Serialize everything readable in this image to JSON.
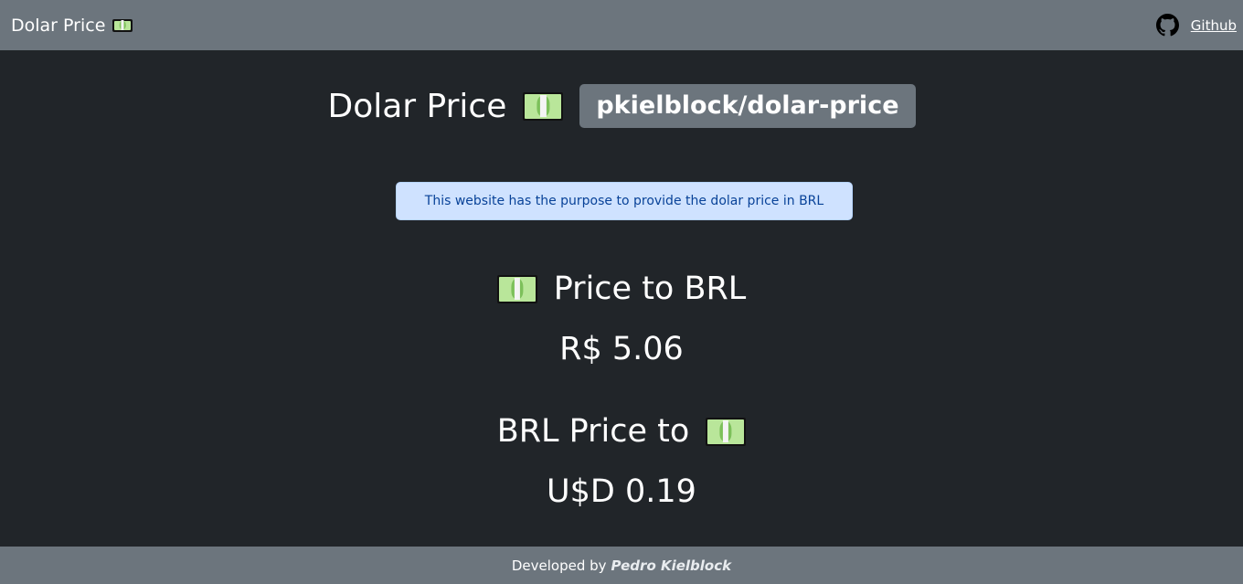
{
  "navbar": {
    "brand": "Dolar Price",
    "brand_icon": "dollar-bill-icon",
    "github_icon": "github-icon",
    "github_link": "Github"
  },
  "header": {
    "title": "Dolar Price",
    "title_icon": "dollar-bill-icon",
    "repo_badge": "pkielblock/dolar-price"
  },
  "alert": {
    "text": "This website has the purpose to provide the dolar price in BRL"
  },
  "usd_to_brl": {
    "title": "Price to BRL",
    "value": "R$ 5.06"
  },
  "brl_to_usd": {
    "title": "BRL Price to",
    "value": "U$D 0.19"
  },
  "footer": {
    "prefix": "Developed by",
    "author": "Pedro Kielblock"
  },
  "colors": {
    "background": "#212529",
    "navbar": "#6c757d",
    "alert_bg": "#cfe2ff",
    "alert_text": "#084298"
  }
}
